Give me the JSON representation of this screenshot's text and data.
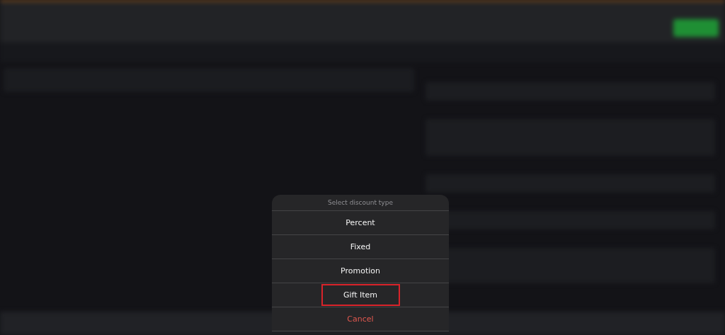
{
  "dialog": {
    "title": "Select discount type",
    "options": [
      {
        "label": "Percent",
        "kind": "option",
        "highlighted": false
      },
      {
        "label": "Fixed",
        "kind": "option",
        "highlighted": false
      },
      {
        "label": "Promotion",
        "kind": "option",
        "highlighted": false
      },
      {
        "label": "Gift Item",
        "kind": "option",
        "highlighted": true
      },
      {
        "label": "Cancel",
        "kind": "cancel",
        "highlighted": false
      }
    ]
  }
}
